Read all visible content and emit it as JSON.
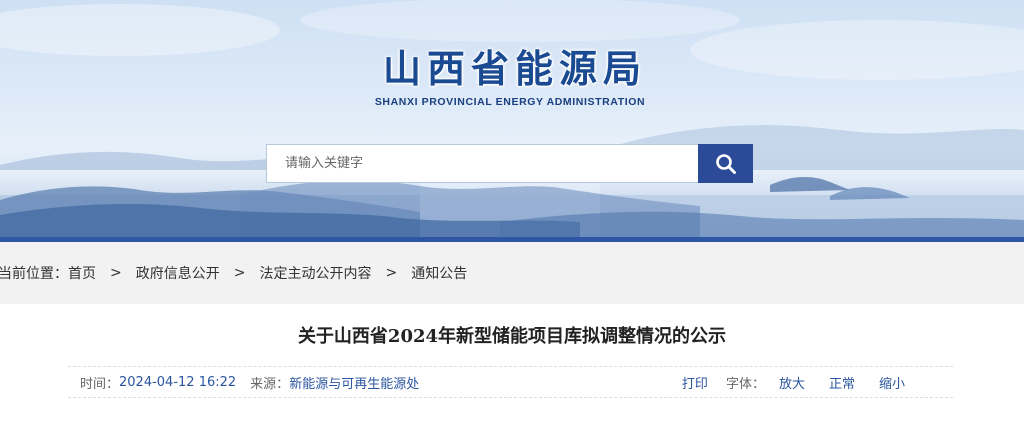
{
  "header": {
    "title": "山西省能源局",
    "subtitle": "SHANXI PROVINCIAL ENERGY ADMINISTRATION",
    "search": {
      "placeholder": "请输入关键字",
      "button_icon": "search-icon"
    },
    "colors": {
      "brand": "#2b4a97",
      "bar": "#2f55a5",
      "title": "#1a4a92"
    }
  },
  "breadcrumb": {
    "lead": "当前位置：",
    "items": [
      "首页",
      "政府信息公开",
      "法定主动公开内容",
      "通知公告"
    ],
    "separator": ">"
  },
  "article": {
    "title": "关于山西省2024年新型储能项目库拟调整情况的公示",
    "meta": {
      "time_label": "时间：",
      "time_value": "2024-04-12 16:22",
      "source_label": "来源：",
      "source_value": "新能源与可再生能源处",
      "print": "打印",
      "font_label": "字体：",
      "font_large": "放大",
      "font_normal": "正常",
      "font_small": "缩小"
    }
  }
}
